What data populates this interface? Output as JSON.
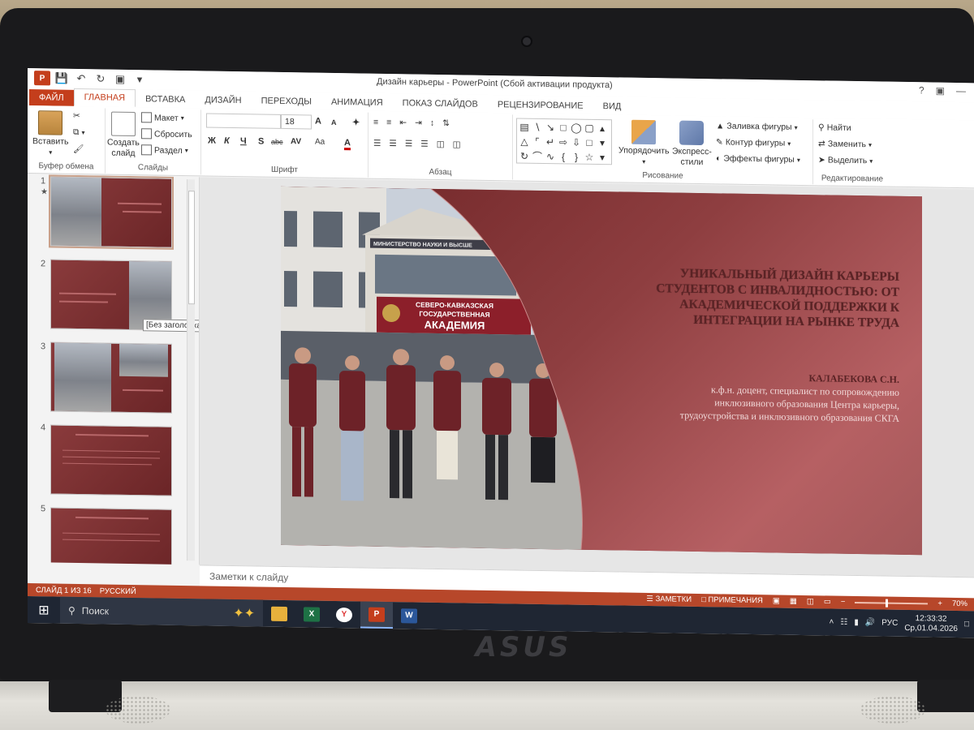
{
  "window": {
    "title": "Дизайн карьеры - PowerPoint (Сбой активации продукта)",
    "controls": [
      "?",
      "▣",
      "—"
    ]
  },
  "tabs": [
    {
      "label": "ФАЙЛ"
    },
    {
      "label": "ГЛАВНАЯ"
    },
    {
      "label": "ВСТАВКА"
    },
    {
      "label": "ДИЗАЙН"
    },
    {
      "label": "ПЕРЕХОДЫ"
    },
    {
      "label": "АНИМАЦИЯ"
    },
    {
      "label": "ПОКАЗ СЛАЙДОВ"
    },
    {
      "label": "РЕЦЕНЗИРОВАНИЕ"
    },
    {
      "label": "ВИД"
    }
  ],
  "active_tab": "ГЛАВНАЯ",
  "ribbon": {
    "clipboard": {
      "paste": "Вставить",
      "label": "Буфер обмена"
    },
    "slides": {
      "new_slide_1": "Создать",
      "new_slide_2": "слайд",
      "layout": "Макет",
      "reset": "Сбросить",
      "section": "Раздел",
      "label": "Слайды"
    },
    "font": {
      "font_size": "18",
      "bold": "Ж",
      "italic": "К",
      "underline": "Ч",
      "shadow": "S",
      "strike": "abc",
      "spacing": "AV",
      "case": "Aa",
      "color": "A",
      "grow": "A",
      "shrink": "A",
      "label": "Шрифт"
    },
    "paragraph": {
      "label": "Абзац"
    },
    "drawing": {
      "arrange": "Упорядочить",
      "quick_styles_1": "Экспресс-",
      "quick_styles_2": "стили",
      "fill": "Заливка фигуры",
      "outline": "Контур фигуры",
      "effects": "Эффекты фигуры",
      "label": "Рисование"
    },
    "editing": {
      "find": "Найти",
      "replace": "Заменить",
      "select": "Выделить",
      "label": "Редактирование"
    }
  },
  "thumbnails": [
    {
      "number": "1"
    },
    {
      "number": "2"
    },
    {
      "number": "3"
    },
    {
      "number": "4"
    },
    {
      "number": "5"
    }
  ],
  "tooltip": "[Без заголовка]",
  "slide": {
    "title": "УНИКАЛЬНЫЙ ДИЗАЙН КАРЬЕРЫ СТУДЕНТОВ С ИНВАЛИДНОСТЬЮ: ОТ АКАДЕМИЧЕСКОЙ ПОДДЕРЖКИ К ИНТЕГРАЦИИ НА РЫНКЕ  ТРУДА",
    "author_name": "КАЛАБЕКОВА С.Н.",
    "author_line1": "к.ф.н. доцент, специалист по сопровождению",
    "author_line2": "инклюзивного образования Центра карьеры,",
    "author_line3": "трудоустройства и инклюзивного образования СКГА",
    "photo_sign_line1": "СЕВЕРО-КАВКАЗСКАЯ",
    "photo_sign_line2": "ГОСУДАРСТВЕННАЯ",
    "photo_sign_line3": "АКАДЕМИЯ",
    "photo_banner": "МИНИСТЕРСТВО НАУКИ И ВЫСШЕ"
  },
  "notes": {
    "placeholder": "Заметки к слайду"
  },
  "status": {
    "slide_info": "СЛАЙД 1 ИЗ 16",
    "language": "РУССКИЙ",
    "notes_btn": "ЗАМЕТКИ",
    "comments_btn": "ПРИМЕЧАНИЯ",
    "zoom": "70%",
    "zoom_level": 0.7
  },
  "taskbar": {
    "search_placeholder": "Поиск",
    "lang": "РУС",
    "time": "12:33:32",
    "date": "Ср,01.04.2026"
  },
  "hardware": {
    "brand": "ASUS"
  },
  "colors": {
    "accent": "#c43e1c",
    "slide_maroon": "#7a2f32",
    "status_bar": "#b7472a"
  }
}
